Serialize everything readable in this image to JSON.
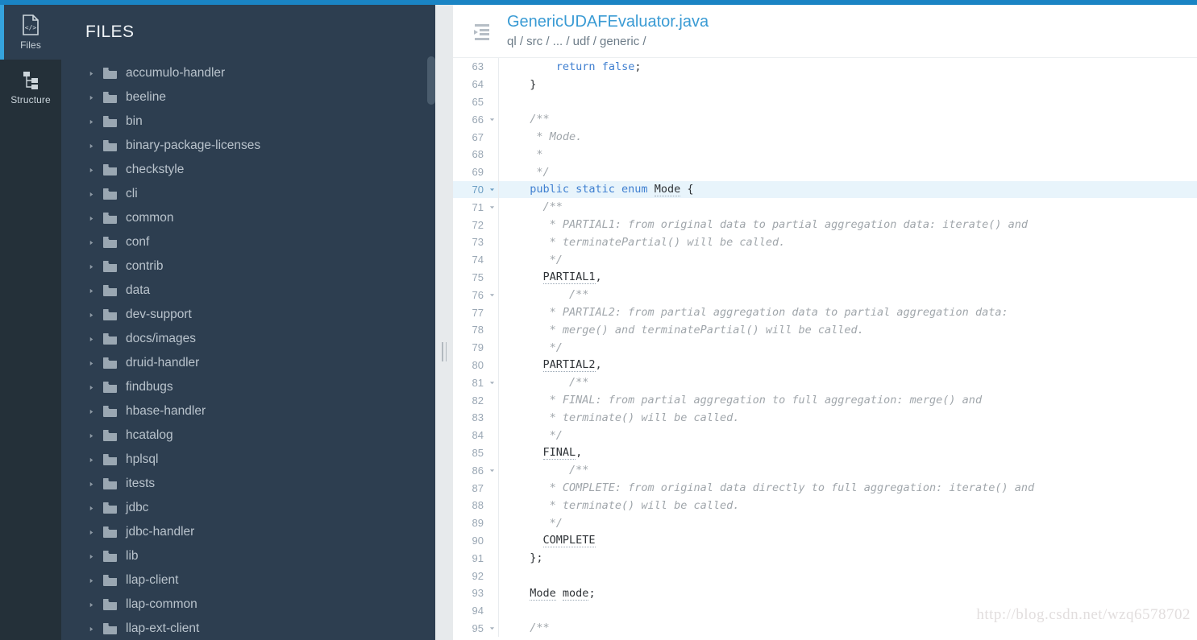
{
  "theme": {
    "accent_bar": "#1a84c4",
    "rail_bg": "#243039",
    "panel_bg": "#2d3e50",
    "active_marker": "#35a3dd",
    "link_blue": "#3a9bd4",
    "keyword_blue": "#3f7fd0",
    "comment_gray": "#a0a6ab",
    "highlight_row": "#e8f4fb"
  },
  "rail": {
    "items": [
      {
        "label": "Files",
        "icon": "file-code-icon",
        "active": true
      },
      {
        "label": "Structure",
        "icon": "structure-tree-icon",
        "active": false
      }
    ]
  },
  "files_panel": {
    "title": "FILES",
    "tree": [
      {
        "label": "accumulo-handler",
        "icon": "folder-icon",
        "expanded": false
      },
      {
        "label": "beeline",
        "icon": "folder-icon",
        "expanded": false
      },
      {
        "label": "bin",
        "icon": "folder-icon",
        "expanded": false
      },
      {
        "label": "binary-package-licenses",
        "icon": "folder-icon",
        "expanded": false
      },
      {
        "label": "checkstyle",
        "icon": "folder-icon",
        "expanded": false
      },
      {
        "label": "cli",
        "icon": "folder-icon",
        "expanded": false
      },
      {
        "label": "common",
        "icon": "folder-icon",
        "expanded": false
      },
      {
        "label": "conf",
        "icon": "folder-icon",
        "expanded": false
      },
      {
        "label": "contrib",
        "icon": "folder-icon",
        "expanded": false
      },
      {
        "label": "data",
        "icon": "folder-icon",
        "expanded": false
      },
      {
        "label": "dev-support",
        "icon": "folder-icon",
        "expanded": false
      },
      {
        "label": "docs/images",
        "icon": "folder-icon",
        "expanded": false
      },
      {
        "label": "druid-handler",
        "icon": "folder-icon",
        "expanded": false
      },
      {
        "label": "findbugs",
        "icon": "folder-icon",
        "expanded": false
      },
      {
        "label": "hbase-handler",
        "icon": "folder-icon",
        "expanded": false
      },
      {
        "label": "hcatalog",
        "icon": "folder-icon",
        "expanded": false
      },
      {
        "label": "hplsql",
        "icon": "folder-icon",
        "expanded": false
      },
      {
        "label": "itests",
        "icon": "folder-icon",
        "expanded": false
      },
      {
        "label": "jdbc",
        "icon": "folder-icon",
        "expanded": false
      },
      {
        "label": "jdbc-handler",
        "icon": "folder-icon",
        "expanded": false
      },
      {
        "label": "lib",
        "icon": "folder-icon",
        "expanded": false
      },
      {
        "label": "llap-client",
        "icon": "folder-icon",
        "expanded": false
      },
      {
        "label": "llap-common",
        "icon": "folder-icon",
        "expanded": false
      },
      {
        "label": "llap-ext-client",
        "icon": "folder-icon",
        "expanded": false
      }
    ]
  },
  "editor": {
    "collapse_icon": "collapse-left-icon",
    "file_name": "GenericUDAFEvaluator.java",
    "breadcrumb": "ql / src / ... / udf / generic /",
    "watermark": "http://blog.csdn.net/wzq6578702",
    "highlighted_line": 70,
    "lines": [
      {
        "n": 63,
        "fold": false,
        "hl": false,
        "tokens": [
          {
            "t": "      ",
            "c": "pln"
          },
          {
            "t": "return",
            "c": "kw"
          },
          {
            "t": " ",
            "c": "pln"
          },
          {
            "t": "false",
            "c": "kw"
          },
          {
            "t": ";",
            "c": "pln"
          }
        ]
      },
      {
        "n": 64,
        "fold": false,
        "hl": false,
        "tokens": [
          {
            "t": "  }",
            "c": "pln"
          }
        ]
      },
      {
        "n": 65,
        "fold": false,
        "hl": false,
        "tokens": []
      },
      {
        "n": 66,
        "fold": true,
        "hl": false,
        "tokens": [
          {
            "t": "  /**",
            "c": "cmt"
          }
        ]
      },
      {
        "n": 67,
        "fold": false,
        "hl": false,
        "tokens": [
          {
            "t": "   * Mode.",
            "c": "cmt"
          }
        ]
      },
      {
        "n": 68,
        "fold": false,
        "hl": false,
        "tokens": [
          {
            "t": "   *",
            "c": "cmt"
          }
        ]
      },
      {
        "n": 69,
        "fold": false,
        "hl": false,
        "tokens": [
          {
            "t": "   */",
            "c": "cmt"
          }
        ]
      },
      {
        "n": 70,
        "fold": true,
        "hl": true,
        "tokens": [
          {
            "t": "  ",
            "c": "pln"
          },
          {
            "t": "public static enum",
            "c": "kw"
          },
          {
            "t": " ",
            "c": "pln"
          },
          {
            "t": "Mode",
            "c": "idn"
          },
          {
            "t": " {",
            "c": "pln"
          }
        ]
      },
      {
        "n": 71,
        "fold": true,
        "hl": false,
        "tokens": [
          {
            "t": "    /**",
            "c": "cmt"
          }
        ]
      },
      {
        "n": 72,
        "fold": false,
        "hl": false,
        "tokens": [
          {
            "t": "     * PARTIAL1: from original data to partial aggregation data: iterate() and",
            "c": "cmt"
          }
        ]
      },
      {
        "n": 73,
        "fold": false,
        "hl": false,
        "tokens": [
          {
            "t": "     * terminatePartial() will be called.",
            "c": "cmt"
          }
        ]
      },
      {
        "n": 74,
        "fold": false,
        "hl": false,
        "tokens": [
          {
            "t": "     */",
            "c": "cmt"
          }
        ]
      },
      {
        "n": 75,
        "fold": false,
        "hl": false,
        "tokens": [
          {
            "t": "    ",
            "c": "pln"
          },
          {
            "t": "PARTIAL1",
            "c": "idn"
          },
          {
            "t": ",",
            "c": "pln"
          }
        ]
      },
      {
        "n": 76,
        "fold": true,
        "hl": false,
        "tokens": [
          {
            "t": "        /**",
            "c": "cmt"
          }
        ]
      },
      {
        "n": 77,
        "fold": false,
        "hl": false,
        "tokens": [
          {
            "t": "     * PARTIAL2: from partial aggregation data to partial aggregation data:",
            "c": "cmt"
          }
        ]
      },
      {
        "n": 78,
        "fold": false,
        "hl": false,
        "tokens": [
          {
            "t": "     * merge() and terminatePartial() will be called.",
            "c": "cmt"
          }
        ]
      },
      {
        "n": 79,
        "fold": false,
        "hl": false,
        "tokens": [
          {
            "t": "     */",
            "c": "cmt"
          }
        ]
      },
      {
        "n": 80,
        "fold": false,
        "hl": false,
        "tokens": [
          {
            "t": "    ",
            "c": "pln"
          },
          {
            "t": "PARTIAL2",
            "c": "idn"
          },
          {
            "t": ",",
            "c": "pln"
          }
        ]
      },
      {
        "n": 81,
        "fold": true,
        "hl": false,
        "tokens": [
          {
            "t": "        /**",
            "c": "cmt"
          }
        ]
      },
      {
        "n": 82,
        "fold": false,
        "hl": false,
        "tokens": [
          {
            "t": "     * FINAL: from partial aggregation to full aggregation: merge() and",
            "c": "cmt"
          }
        ]
      },
      {
        "n": 83,
        "fold": false,
        "hl": false,
        "tokens": [
          {
            "t": "     * terminate() will be called.",
            "c": "cmt"
          }
        ]
      },
      {
        "n": 84,
        "fold": false,
        "hl": false,
        "tokens": [
          {
            "t": "     */",
            "c": "cmt"
          }
        ]
      },
      {
        "n": 85,
        "fold": false,
        "hl": false,
        "tokens": [
          {
            "t": "    ",
            "c": "pln"
          },
          {
            "t": "FINAL",
            "c": "idn"
          },
          {
            "t": ",",
            "c": "pln"
          }
        ]
      },
      {
        "n": 86,
        "fold": true,
        "hl": false,
        "tokens": [
          {
            "t": "        /**",
            "c": "cmt"
          }
        ]
      },
      {
        "n": 87,
        "fold": false,
        "hl": false,
        "tokens": [
          {
            "t": "     * COMPLETE: from original data directly to full aggregation: iterate() and",
            "c": "cmt"
          }
        ]
      },
      {
        "n": 88,
        "fold": false,
        "hl": false,
        "tokens": [
          {
            "t": "     * terminate() will be called.",
            "c": "cmt"
          }
        ]
      },
      {
        "n": 89,
        "fold": false,
        "hl": false,
        "tokens": [
          {
            "t": "     */",
            "c": "cmt"
          }
        ]
      },
      {
        "n": 90,
        "fold": false,
        "hl": false,
        "tokens": [
          {
            "t": "    ",
            "c": "pln"
          },
          {
            "t": "COMPLETE",
            "c": "idn"
          }
        ]
      },
      {
        "n": 91,
        "fold": false,
        "hl": false,
        "tokens": [
          {
            "t": "  };",
            "c": "pln"
          }
        ]
      },
      {
        "n": 92,
        "fold": false,
        "hl": false,
        "tokens": []
      },
      {
        "n": 93,
        "fold": false,
        "hl": false,
        "tokens": [
          {
            "t": "  ",
            "c": "pln"
          },
          {
            "t": "Mode",
            "c": "idn"
          },
          {
            "t": " ",
            "c": "pln"
          },
          {
            "t": "mode",
            "c": "idn"
          },
          {
            "t": ";",
            "c": "pln"
          }
        ]
      },
      {
        "n": 94,
        "fold": false,
        "hl": false,
        "tokens": []
      },
      {
        "n": 95,
        "fold": true,
        "hl": false,
        "tokens": [
          {
            "t": "  /**",
            "c": "cmt"
          }
        ]
      }
    ]
  }
}
